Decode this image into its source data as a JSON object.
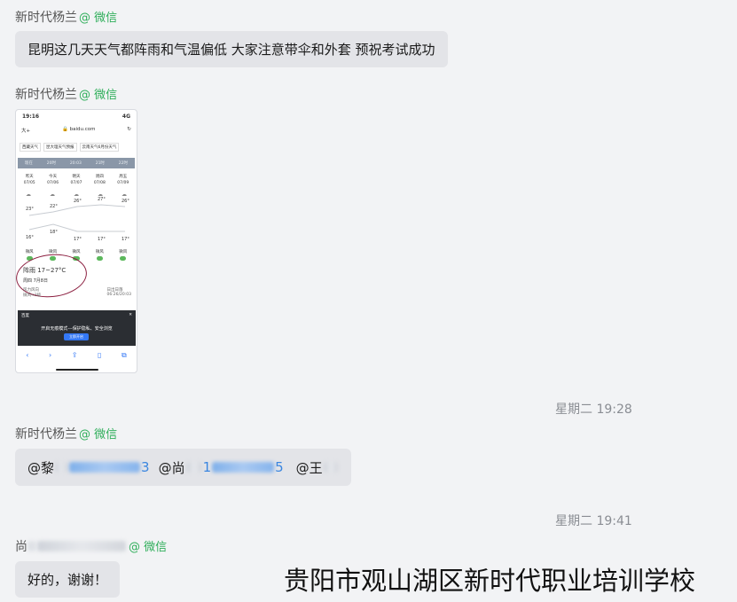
{
  "messages": [
    {
      "sender": "新时代杨兰",
      "tag": "@ 微信",
      "text": "昆明这几天天气都阵雨和气温偏低 大家注意带伞和外套 预祝考试成功"
    },
    {
      "sender": "新时代杨兰",
      "tag": "@ 微信"
    },
    {
      "sender": "新时代杨兰",
      "tag": "@ 微信",
      "mentions": [
        "@黎",
        "@尚",
        "@王"
      ],
      "mention_numbers": [
        "1",
        "3",
        "1",
        "5"
      ]
    },
    {
      "sender": "尚",
      "tag": "@ 微信",
      "text": "好的，谢谢！"
    }
  ],
  "timestamps": [
    "星期二 19:28",
    "星期二 19:41"
  ],
  "phone": {
    "status_time": "19:16",
    "status_signal": "4G",
    "url_left": "大+",
    "url": "baidu.com",
    "chips": [
      "西藏天气",
      "昆大理天气预报",
      "云南天气6月份天气"
    ],
    "hours": [
      "现在",
      "20时",
      "20:03",
      "21时",
      "22时"
    ],
    "days": [
      {
        "name": "昨天",
        "date": "07/05"
      },
      {
        "name": "今天",
        "date": "07/06"
      },
      {
        "name": "明天",
        "date": "07/07"
      },
      {
        "name": "周四",
        "date": "07/08"
      },
      {
        "name": "周五",
        "date": "07/09"
      }
    ],
    "highs": [
      "23°",
      "22°",
      "26°",
      "27°",
      "26°"
    ],
    "lows": [
      "16°",
      "18°",
      "17°",
      "17°",
      "17°"
    ],
    "winds": [
      "微风",
      "微风",
      "微风",
      "微风",
      "微风"
    ],
    "today_title": "阵雨  17~27°C",
    "today_date": "周四 7月8日",
    "info_left": "微风<3级",
    "info_right": "06:26/20:03",
    "info_left_label": "风力风向",
    "info_right_label": "日出日落",
    "popup_app": "百度",
    "popup_title": "开启无痕模式---保护隐私、安全浏览",
    "popup_button": "立即开启"
  },
  "watermark": "贵阳市观山湖区新时代职业培训学校",
  "colors": {
    "background": "#f2f3f5",
    "bubble": "#e3e4e8",
    "tag": "#2fae5a",
    "link": "#3a86e0",
    "time": "#8a8d93"
  }
}
